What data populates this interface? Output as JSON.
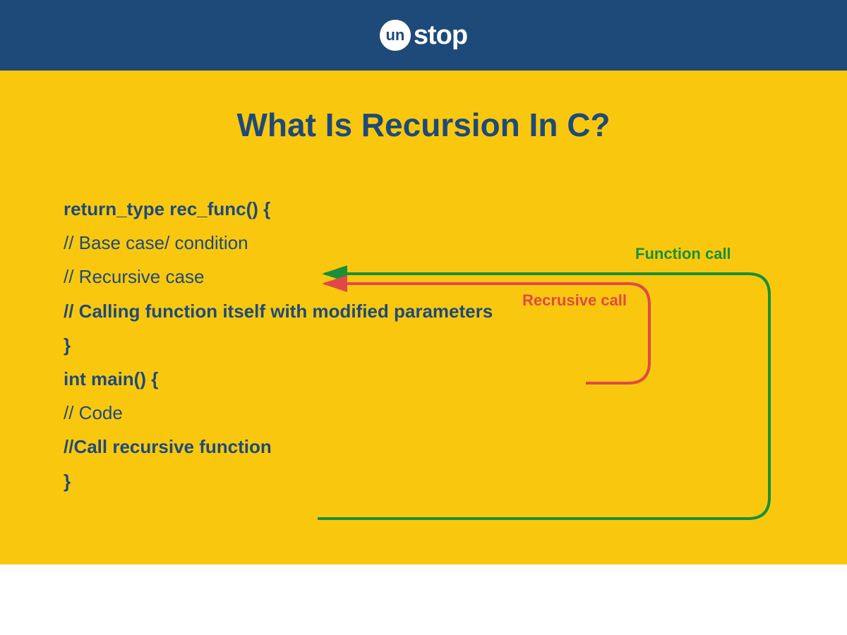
{
  "brand": {
    "circle_text": "un",
    "word": "stop"
  },
  "title": "What Is Recursion In C?",
  "code": {
    "l1": "return_type rec_func() {",
    "l2": "// Base case/ condition",
    "l3": "// Recursive case",
    "l4": "// Calling function itself with modified parameters",
    "l5": "}",
    "l6": "int main() {",
    "l7": "// Code",
    "l8": "//Call recursive function",
    "l9": "}"
  },
  "labels": {
    "function_call": "Function call",
    "recursive_call": "Recrusive call"
  },
  "colors": {
    "header_bg": "#1e4a7a",
    "content_bg": "#f9c80e",
    "text": "#1e4a7a",
    "green": "#1a8f3a",
    "red": "#e04848"
  }
}
